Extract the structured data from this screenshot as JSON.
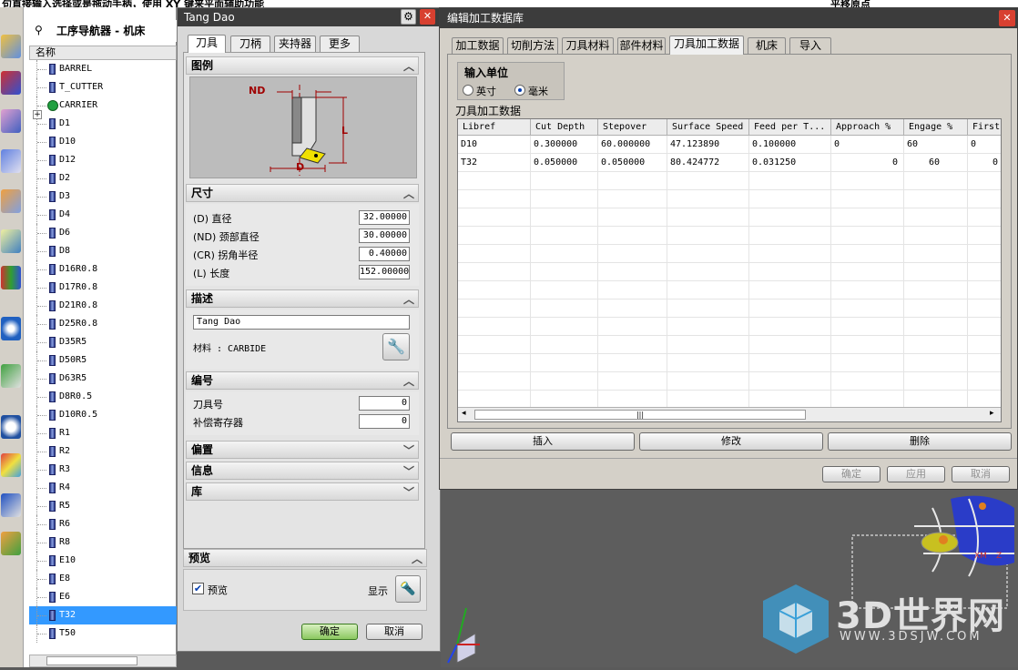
{
  "top_strip": {
    "left_text": "句直接输入选择或是拖动手柄，使用 XY 键来平面辅助功能",
    "right_text": "平移原点"
  },
  "navigator": {
    "title": "工序导航器 - 机床",
    "column_header": "名称",
    "items": [
      {
        "label": "BARREL"
      },
      {
        "label": "T_CUTTER"
      },
      {
        "label": "CARRIER"
      },
      {
        "label": "D1"
      },
      {
        "label": "D10"
      },
      {
        "label": "D12"
      },
      {
        "label": "D2"
      },
      {
        "label": "D3"
      },
      {
        "label": "D4"
      },
      {
        "label": "D6"
      },
      {
        "label": "D8"
      },
      {
        "label": "D16R0.8"
      },
      {
        "label": "D17R0.8"
      },
      {
        "label": "D21R0.8"
      },
      {
        "label": "D25R0.8"
      },
      {
        "label": "D35R5"
      },
      {
        "label": "D50R5"
      },
      {
        "label": "D63R5"
      },
      {
        "label": "D8R0.5"
      },
      {
        "label": "D10R0.5"
      },
      {
        "label": "R1"
      },
      {
        "label": "R2"
      },
      {
        "label": "R3"
      },
      {
        "label": "R4"
      },
      {
        "label": "R5"
      },
      {
        "label": "R6"
      },
      {
        "label": "R8"
      },
      {
        "label": "E10"
      },
      {
        "label": "E8"
      },
      {
        "label": "E6"
      },
      {
        "label": "T32"
      },
      {
        "label": "T50"
      }
    ],
    "selected": "T32"
  },
  "tool_dialog": {
    "title": "Tang Dao",
    "tabs": [
      "刀具",
      "刀柄",
      "夹持器",
      "更多"
    ],
    "active_tab": "刀具",
    "sections": {
      "legend": "图例",
      "dimensions": "尺寸",
      "description": "描述",
      "numbering": "编号",
      "offset": "偏置",
      "info": "信息",
      "library": "库",
      "preview": "预览"
    },
    "diagram_labels": {
      "nd": "ND",
      "l": "L",
      "d": "D"
    },
    "fields": {
      "diameter": {
        "label": "(D) 直径",
        "value": "32.00000"
      },
      "neck_diameter": {
        "label": "(ND) 颈部直径",
        "value": "30.00000"
      },
      "corner_radius": {
        "label": "(CR) 拐角半径",
        "value": "0.40000"
      },
      "length": {
        "label": "(L) 长度",
        "value": "152.00000"
      },
      "description_text": "Tang Dao",
      "material": "材料 : CARBIDE",
      "tool_number": {
        "label": "刀具号",
        "value": "0"
      },
      "compensation_register": {
        "label": "补偿寄存器",
        "value": "0"
      }
    },
    "preview": {
      "checkbox_label": "预览",
      "checked": true,
      "show_label": "显示"
    },
    "ok_label": "确定",
    "cancel_label": "取消"
  },
  "db_dialog": {
    "title": "编辑加工数据库",
    "tabs": [
      "加工数据",
      "切削方法",
      "刀具材料",
      "部件材料",
      "刀具加工数据",
      "机床",
      "导入"
    ],
    "active_tab": "刀具加工数据",
    "unit_group": {
      "title": "输入单位",
      "options": [
        "英寸",
        "毫米"
      ],
      "selected": "毫米"
    },
    "table_label": "刀具加工数据",
    "columns": [
      "Libref",
      "Cut Depth",
      "Stepover",
      "Surface Speed",
      "Feed per T...",
      "Approach %",
      "Engage %",
      "First"
    ],
    "rows": [
      [
        "D10",
        "0.300000",
        "60.000000",
        "47.123890",
        "0.100000",
        "0",
        "60",
        "0"
      ],
      [
        "T32",
        "0.050000",
        "0.050000",
        "80.424772",
        "0.031250",
        "0",
        "60",
        "0"
      ]
    ],
    "buttons": {
      "insert": "插入",
      "modify": "修改",
      "delete": "删除"
    },
    "bottom_buttons": {
      "ok": "确定",
      "apply": "应用",
      "cancel": "取消"
    }
  },
  "watermark": {
    "brand": "3D世界网",
    "url": "WWW.3DSJW.COM"
  },
  "colors": {
    "selection": "#3399ff",
    "title_bar": "#3c3c3c",
    "dialog_bg": "#d4d0c8",
    "dim_red": "#a00000",
    "viewport": "#5a5a5a"
  }
}
